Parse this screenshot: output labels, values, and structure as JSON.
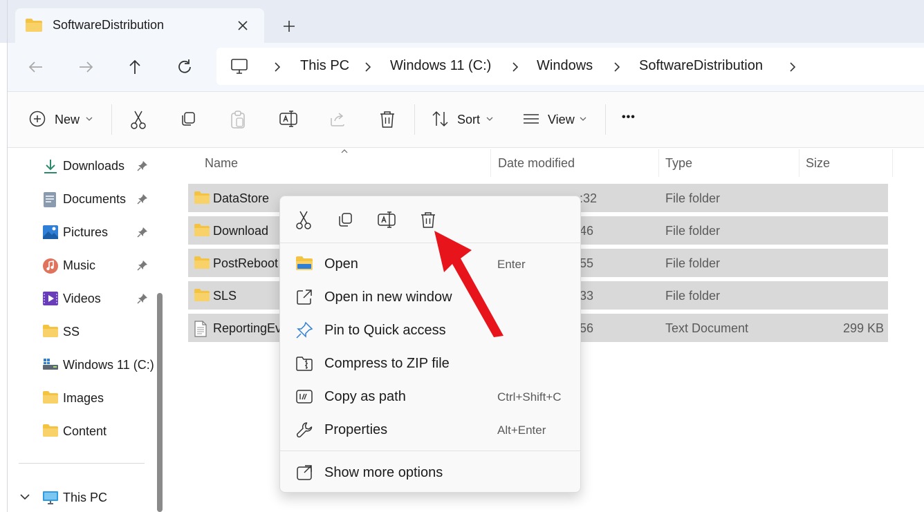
{
  "window": {
    "tab_title": "SoftwareDistribution"
  },
  "breadcrumb": [
    "This PC",
    "Windows 11 (C:)",
    "Windows",
    "SoftwareDistribution"
  ],
  "toolbar": {
    "new_label": "New",
    "sort_label": "Sort",
    "view_label": "View",
    "more_glyph": "•••"
  },
  "sidebar": {
    "items": [
      {
        "label": "Downloads",
        "icon": "download-icon",
        "pinned": true
      },
      {
        "label": "Documents",
        "icon": "documents-icon",
        "pinned": true
      },
      {
        "label": "Pictures",
        "icon": "pictures-icon",
        "pinned": true
      },
      {
        "label": "Music",
        "icon": "music-icon",
        "pinned": true
      },
      {
        "label": "Videos",
        "icon": "videos-icon",
        "pinned": true
      },
      {
        "label": "SS",
        "icon": "folder-icon",
        "pinned": false
      },
      {
        "label": "Windows 11 (C:)",
        "icon": "drive-icon",
        "pinned": false
      },
      {
        "label": "Images",
        "icon": "folder-icon",
        "pinned": false
      },
      {
        "label": "Content",
        "icon": "folder-icon",
        "pinned": false
      }
    ],
    "this_pc_label": "This PC"
  },
  "columns": [
    "Name",
    "Date modified",
    "Type",
    "Size"
  ],
  "rows": [
    {
      "name": "DataStore",
      "date": ":32",
      "type": "File folder",
      "size": "",
      "icon": "folder-icon"
    },
    {
      "name": "Download",
      "date": "46",
      "type": "File folder",
      "size": "",
      "icon": "folder-icon"
    },
    {
      "name": "PostReboot",
      "date": "55",
      "type": "File folder",
      "size": "",
      "icon": "folder-icon"
    },
    {
      "name": "SLS",
      "date": "33",
      "type": "File folder",
      "size": "",
      "icon": "folder-icon"
    },
    {
      "name": "ReportingEv",
      "date": "56",
      "type": "Text Document",
      "size": "299 KB",
      "icon": "text-file-icon"
    }
  ],
  "context_menu": {
    "items": [
      {
        "label": "Open",
        "shortcut": "Enter",
        "icon": "folder-open-icon"
      },
      {
        "label": "Open in new window",
        "shortcut": "",
        "icon": "open-new-window-icon"
      },
      {
        "label": "Pin to Quick access",
        "shortcut": "",
        "icon": "pin-icon"
      },
      {
        "label": "Compress to ZIP file",
        "shortcut": "",
        "icon": "zip-icon"
      },
      {
        "label": "Copy as path",
        "shortcut": "Ctrl+Shift+C",
        "icon": "copy-path-icon"
      },
      {
        "label": "Properties",
        "shortcut": "Alt+Enter",
        "icon": "wrench-icon"
      }
    ],
    "more_options_label": "Show more options"
  },
  "colors": {
    "selection": "#d9d9d9",
    "folder": "#f5c342",
    "accent": "#0067c0",
    "arrow": "#e8141c"
  }
}
